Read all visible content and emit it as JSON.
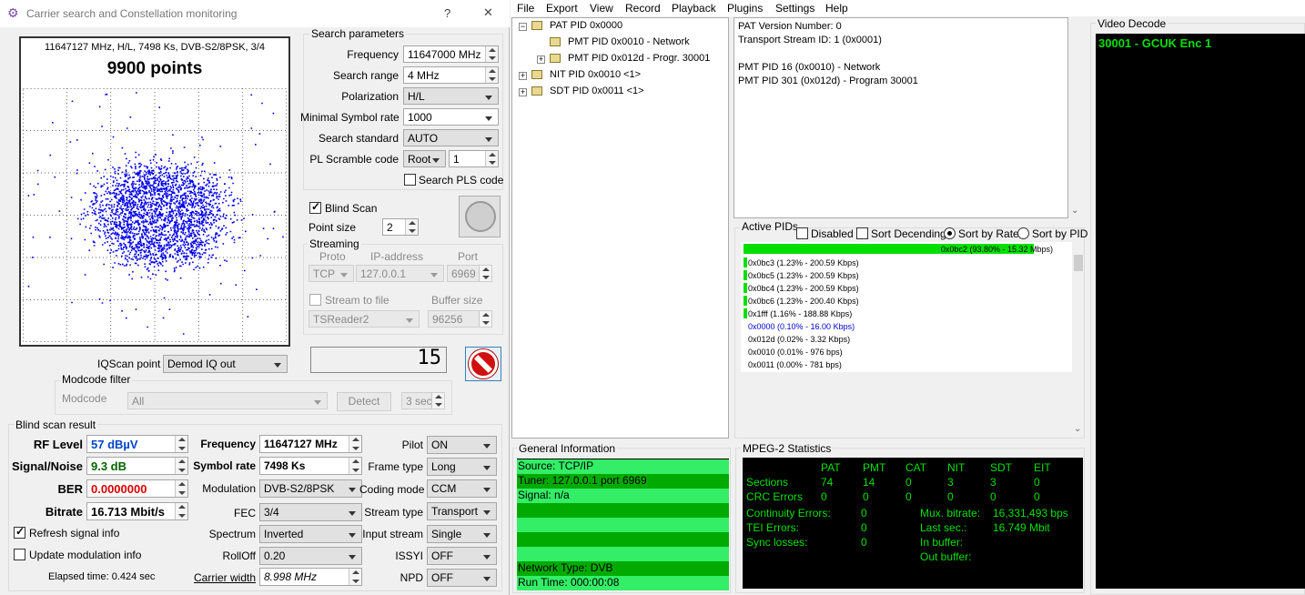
{
  "window": {
    "title": "Carrier search and Constellation monitoring",
    "help": "?",
    "close": "✕"
  },
  "constellation": {
    "info": "11647127 MHz, H/L, 7498 Ks, DVB-S2/8PSK, 3/4",
    "points": "9900 points"
  },
  "search_params": {
    "title": "Search parameters",
    "frequency_label": "Frequency",
    "frequency_value": "11647000 MHz",
    "range_label": "Search range",
    "range_value": "4 MHz",
    "polarization_label": "Polarization",
    "polarization_value": "H/L",
    "min_sr_label": "Minimal Symbol rate",
    "min_sr_value": "1000",
    "standard_label": "Search standard",
    "standard_value": "AUTO",
    "pls_label": "PL Scramble code",
    "pls_mode": "Root",
    "pls_value": "1",
    "search_pls_label": "Search PLS code"
  },
  "blind": {
    "label": "Blind Scan",
    "point_size_label": "Point size",
    "point_size_value": "2"
  },
  "streaming": {
    "title": "Streaming",
    "proto_label": "Proto",
    "ip_label": "IP-address",
    "port_label": "Port",
    "proto_value": "TCP",
    "ip_value": "127.0.0.1",
    "port_value": "6969",
    "file_label": "Stream to file",
    "buffer_label": "Buffer size",
    "file_value": "TSReader2",
    "buffer_value": "96256"
  },
  "iq": {
    "label": "IQScan point",
    "value": "Demod IQ out",
    "counter": "15"
  },
  "modcode": {
    "title": "Modcode filter",
    "label": "Modcode",
    "value": "All",
    "detect": "Detect",
    "seconds": "3 sec"
  },
  "result": {
    "title": "Blind scan result",
    "rf_label": "RF Level",
    "rf_value": "57 dBµV",
    "snr_label": "Signal/Noise",
    "snr_value": "9.3 dB",
    "ber_label": "BER",
    "ber_value": "0.0000000",
    "bitrate_label": "Bitrate",
    "bitrate_value": "16.713 Mbit/s",
    "freq_label": "Frequency",
    "freq_value": "11647127 MHz",
    "sr_label": "Symbol rate",
    "sr_value": "7498 Ks",
    "mod_label": "Modulation",
    "mod_value": "DVB-S2/8PSK",
    "fec_label": "FEC",
    "fec_value": "3/4",
    "spectrum_label": "Spectrum",
    "spectrum_value": "Inverted",
    "rolloff_label": "RollOff",
    "rolloff_value": "0.20",
    "cw_label": "Carrier width",
    "cw_value": "8.998 MHz",
    "pilot_label": "Pilot",
    "pilot_value": "ON",
    "frame_label": "Frame type",
    "frame_value": "Long",
    "coding_label": "Coding mode",
    "coding_value": "CCM",
    "stype_label": "Stream type",
    "stype_value": "Transport",
    "istream_label": "Input stream",
    "istream_value": "Single",
    "issyi_label": "ISSYI",
    "issyi_value": "OFF",
    "npd_label": "NPD",
    "npd_value": "OFF",
    "refresh_label": "Refresh signal info",
    "update_label": "Update modulation info",
    "elapsed": "Elapsed time: 0.424 sec"
  },
  "menu": [
    "File",
    "Export",
    "View",
    "Record",
    "Playback",
    "Plugins",
    "Settings",
    "Help"
  ],
  "tree": [
    {
      "label": "PAT PID 0x0000",
      "icon": "pat"
    },
    {
      "label": "PMT PID 0x0010 - Network",
      "icon": "pmt"
    },
    {
      "label": "PMT PID 0x012d - Progr. 30001",
      "icon": "pmt"
    },
    {
      "label": "NIT PID 0x0010 <1>",
      "icon": "nit"
    },
    {
      "label": "SDT PID 0x0011 <1>",
      "icon": "sdt"
    }
  ],
  "details": [
    "PAT Version Number: 0",
    "Transport Stream ID: 1 (0x0001)",
    "",
    "PMT PID 16 (0x0010) - Network",
    "PMT PID 301 (0x012d) - Program 30001"
  ],
  "active_pids": {
    "title": "Active PIDs",
    "disabled": "Disabled",
    "sort_desc": "Sort Decending",
    "sort_rate": "Sort by Rate",
    "sort_pid": "Sort by PID",
    "top": "0x0bc2 (93.80% - 15.32 Mbps)",
    "top_pct": 93.8,
    "rows": [
      {
        "text": "0x0bc3 (1.23% - 200.59 Kbps)",
        "bar": true,
        "blue": false
      },
      {
        "text": "0x0bc5 (1.23% - 200.59 Kbps)",
        "bar": true,
        "blue": false
      },
      {
        "text": "0x0bc4 (1.23% - 200.59 Kbps)",
        "bar": true,
        "blue": false
      },
      {
        "text": "0x0bc6 (1.23% - 200.40 Kbps)",
        "bar": true,
        "blue": false
      },
      {
        "text": "0x1fff (1.16% - 188.88 Kbps)",
        "bar": true,
        "blue": false
      },
      {
        "text": "0x0000 (0.10% - 16.00 Kbps)",
        "bar": false,
        "blue": true
      },
      {
        "text": "0x012d (0.02% - 3.32 Kbps)",
        "bar": false,
        "blue": false
      },
      {
        "text": "0x0010 (0.01% - 976 bps)",
        "bar": false,
        "blue": false
      },
      {
        "text": "0x0011 (0.00% - 781 bps)",
        "bar": false,
        "blue": false
      }
    ]
  },
  "general": {
    "title": "General Information",
    "rows": [
      "Source: TCP/IP",
      "Tuner: 127.0.0.1 port 6969",
      "Signal: n/a",
      "",
      "",
      "",
      "",
      "Network Type: DVB",
      "Run Time: 000:00:08"
    ]
  },
  "mpeg": {
    "title": "MPEG-2 Statistics",
    "headers": [
      "PAT",
      "PMT",
      "CAT",
      "NIT",
      "SDT",
      "EIT"
    ],
    "sections_label": "Sections",
    "sections": [
      "74",
      "14",
      "0",
      "3",
      "3",
      "0"
    ],
    "crc_label": "CRC Errors",
    "crc": [
      "0",
      "0",
      "0",
      "0",
      "0",
      "0"
    ],
    "cont_label": "Continuity Errors:",
    "cont": "0",
    "tei_label": "TEI Errors:",
    "tei": "0",
    "sync_label": "Sync losses:",
    "sync": "0",
    "mux_label": "Mux. bitrate:",
    "mux": "16,331,493 bps",
    "last_label": "Last sec.:",
    "last": "16.749 Mbit",
    "inbuf_label": "In buffer:",
    "outbuf_label": "Out buffer:"
  },
  "video": {
    "title": "Video Decode",
    "channel": "30001 - GCUK Enc 1"
  },
  "colors": {
    "accent_green": "#00e000",
    "rf_blue": "#0044cc",
    "ber_red": "#dd0000",
    "panel_black": "#000000"
  }
}
